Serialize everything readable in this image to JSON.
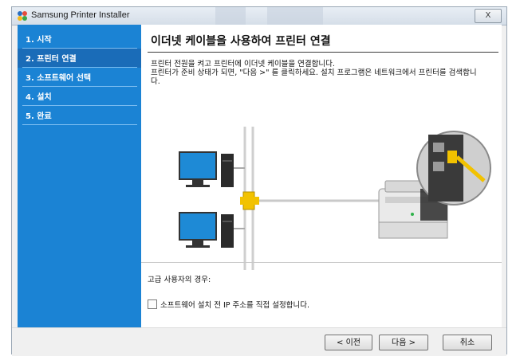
{
  "window": {
    "title": "Samsung Printer Installer",
    "close_label": "X"
  },
  "sidebar": {
    "steps": [
      {
        "label": "1. 시작"
      },
      {
        "label": "2. 프린터 연결"
      },
      {
        "label": "3. 소프트웨어 선택"
      },
      {
        "label": "4. 설치"
      },
      {
        "label": "5. 완료"
      }
    ],
    "active_index": 1
  },
  "main": {
    "heading": "이더넷 케이블을 사용하여 프린터 연결",
    "desc_line1": "프린터 전원을 켜고 프린터에 이더넷 케이블을 연결합니다.",
    "desc_line2": "프린터가 준비 상태가 되면, \"다음 >\" 를 클릭하세요. 설치 프로그램은 네트워크에서 프린터를 검색합니",
    "desc_line3": "다."
  },
  "advanced": {
    "label": "고급 사용자의 경우:",
    "checkbox_label": "소프트웨어 설치 전 IP 주소를 직접 설정합니다.",
    "checkbox_checked": false
  },
  "footer": {
    "back_label": "< 이전",
    "next_label": "다음 >",
    "cancel_label": "취소"
  },
  "colors": {
    "sidebar": "#1b83d4",
    "cable": "#f2c200",
    "monitor": "#1e8ad6"
  }
}
